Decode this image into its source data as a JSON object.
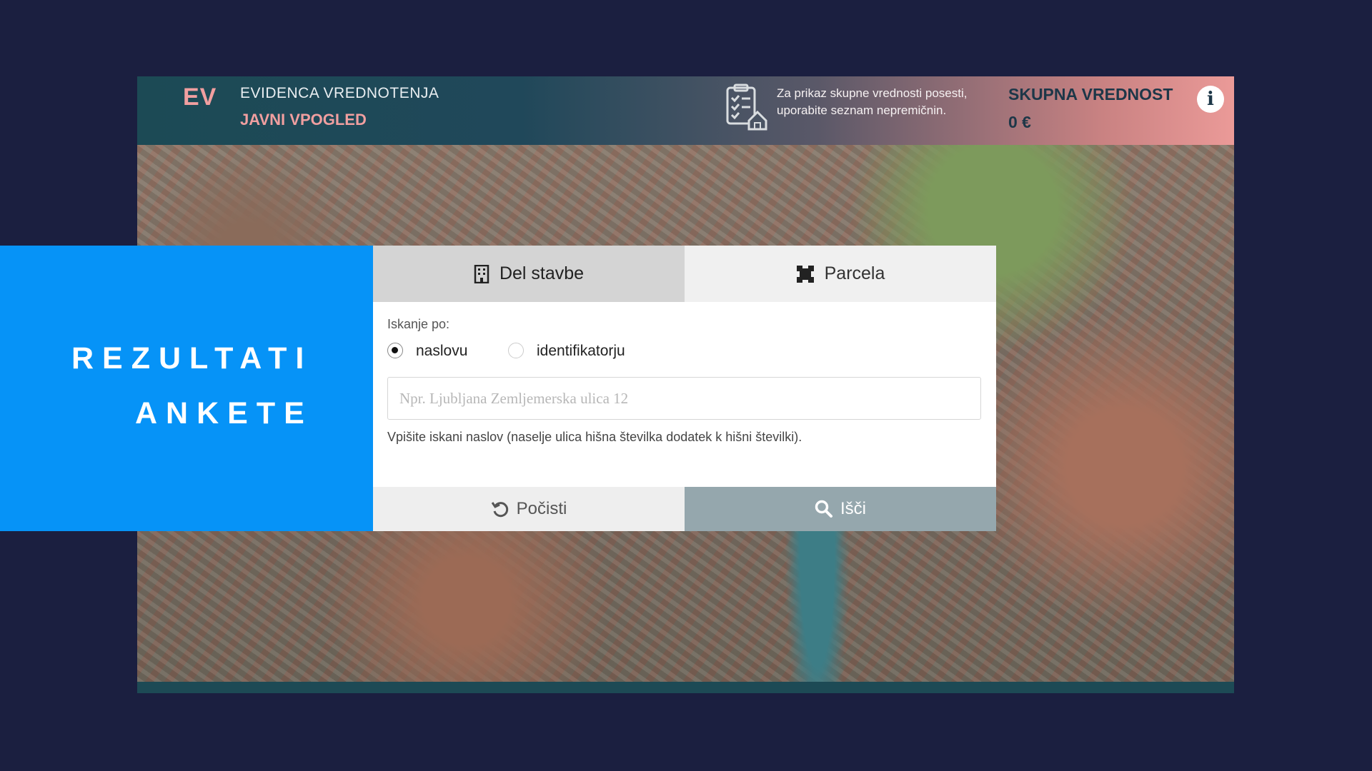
{
  "header": {
    "logo": "EV",
    "title_line1": "EVIDENCA VREDNOTENJA",
    "title_line2": "JAVNI VPOGLED",
    "hint": "Za prikaz skupne vrednosti posesti, uporabite seznam nepremičnin.",
    "total_label": "SKUPNA VREDNOST",
    "total_value": "0 €",
    "info_label": "i"
  },
  "overlay": {
    "line1": "REZULTATI",
    "line2": "ANKETE"
  },
  "search_card": {
    "tabs": [
      {
        "label": "Del stavbe",
        "icon": "building-icon",
        "active": true
      },
      {
        "label": "Parcela",
        "icon": "parcel-icon",
        "active": false
      }
    ],
    "search_by_label": "Iskanje po:",
    "options": [
      {
        "label": "naslovu",
        "checked": true
      },
      {
        "label": "identifikatorju",
        "checked": false
      }
    ],
    "input_placeholder": "Npr. Ljubljana Zemljemerska ulica 12",
    "input_value": "",
    "help_text": "Vpišite iskani naslov (naselje ulica hišna številka dodatek k hišni številki).",
    "reset_label": "Počisti",
    "search_label": "Išči"
  },
  "colors": {
    "background": "#1b1f40",
    "accent_pink": "#f19fa0",
    "blue_panel": "#0693f7",
    "search_button": "#95a7ad"
  }
}
